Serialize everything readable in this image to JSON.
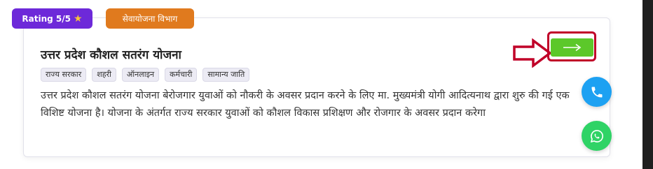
{
  "badges": {
    "rating_label": "Rating 5/5",
    "rating_icon": "star-icon",
    "department": "सेवायोजना विभाग"
  },
  "scheme": {
    "title": "उत्तर प्रदेश कौशल सतरंग योजना",
    "tags": [
      "राज्य सरकार",
      "शहरी",
      "ऑनलाइन",
      "कर्मचारी",
      "सामान्य जाति"
    ],
    "description": "उत्तर प्रदेश कौशल सतरंग योजना बेरोजगार युवाओं को नौकरी के अवसर प्रदान करने के लिए मा. मुख्यमंत्री योगी आदित्यनाथ द्वारा शुरु की गई एक विशिष्ट योजना है। योजना के अंतर्गत राज्य सरकार युवाओं को कौशल विकास प्रशिक्षण और रोजगार के अवसर प्रदान करेगा"
  },
  "actions": {
    "go_icon": "arrow-right-icon",
    "call_icon": "phone-icon",
    "whatsapp_icon": "whatsapp-icon"
  },
  "colors": {
    "rating_badge": "#6d29d9",
    "department_badge": "#e07a1e",
    "go_button": "#5cc82a",
    "annotation_red": "#c00028",
    "call_fab": "#1da1f2",
    "whatsapp_fab": "#2fd366"
  }
}
